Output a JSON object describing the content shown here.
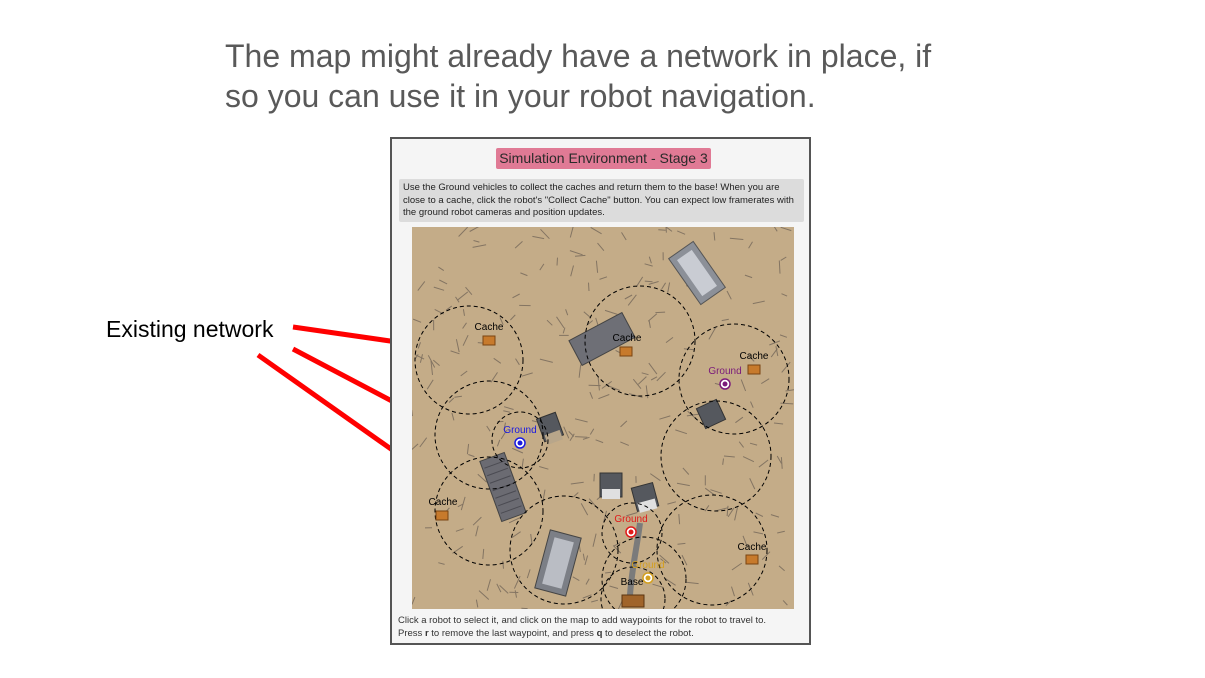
{
  "slide": {
    "line1": "The map might already have a network in place, if",
    "line2": "so you can use it in your robot navigation."
  },
  "annotation": {
    "label": "Existing network",
    "arrow_color": "#ff0000"
  },
  "panel": {
    "title": "Simulation Environment - Stage 3",
    "title_color": "#e07a95",
    "instructions": "Use the Ground vehicles to collect the caches and return them to the base! When you are close to a cache, click the robot's \"Collect Cache\" button. You can expect low framerates with the ground robot cameras and position updates.",
    "footer": {
      "part1": "Click a robot to select it, and click on the map to add waypoints for the robot to travel to.",
      "part2": "Press ",
      "key_r": "r",
      "part3": " to remove the last waypoint, and press ",
      "key_q": "q",
      "part4": " to deselect the robot."
    }
  },
  "map": {
    "caches": [
      {
        "label": "Cache"
      },
      {
        "label": "Cache"
      },
      {
        "label": "Cache"
      },
      {
        "label": "Cache"
      },
      {
        "label": "Cache"
      }
    ],
    "robots": [
      {
        "label": "Ground",
        "color": "#7a1a7a"
      },
      {
        "label": "Ground",
        "color": "#1a1ae0"
      },
      {
        "label": "Ground",
        "color": "#e01a1a"
      },
      {
        "label": "Ground",
        "color": "#d4a020"
      }
    ],
    "base": {
      "label": "Base"
    }
  }
}
